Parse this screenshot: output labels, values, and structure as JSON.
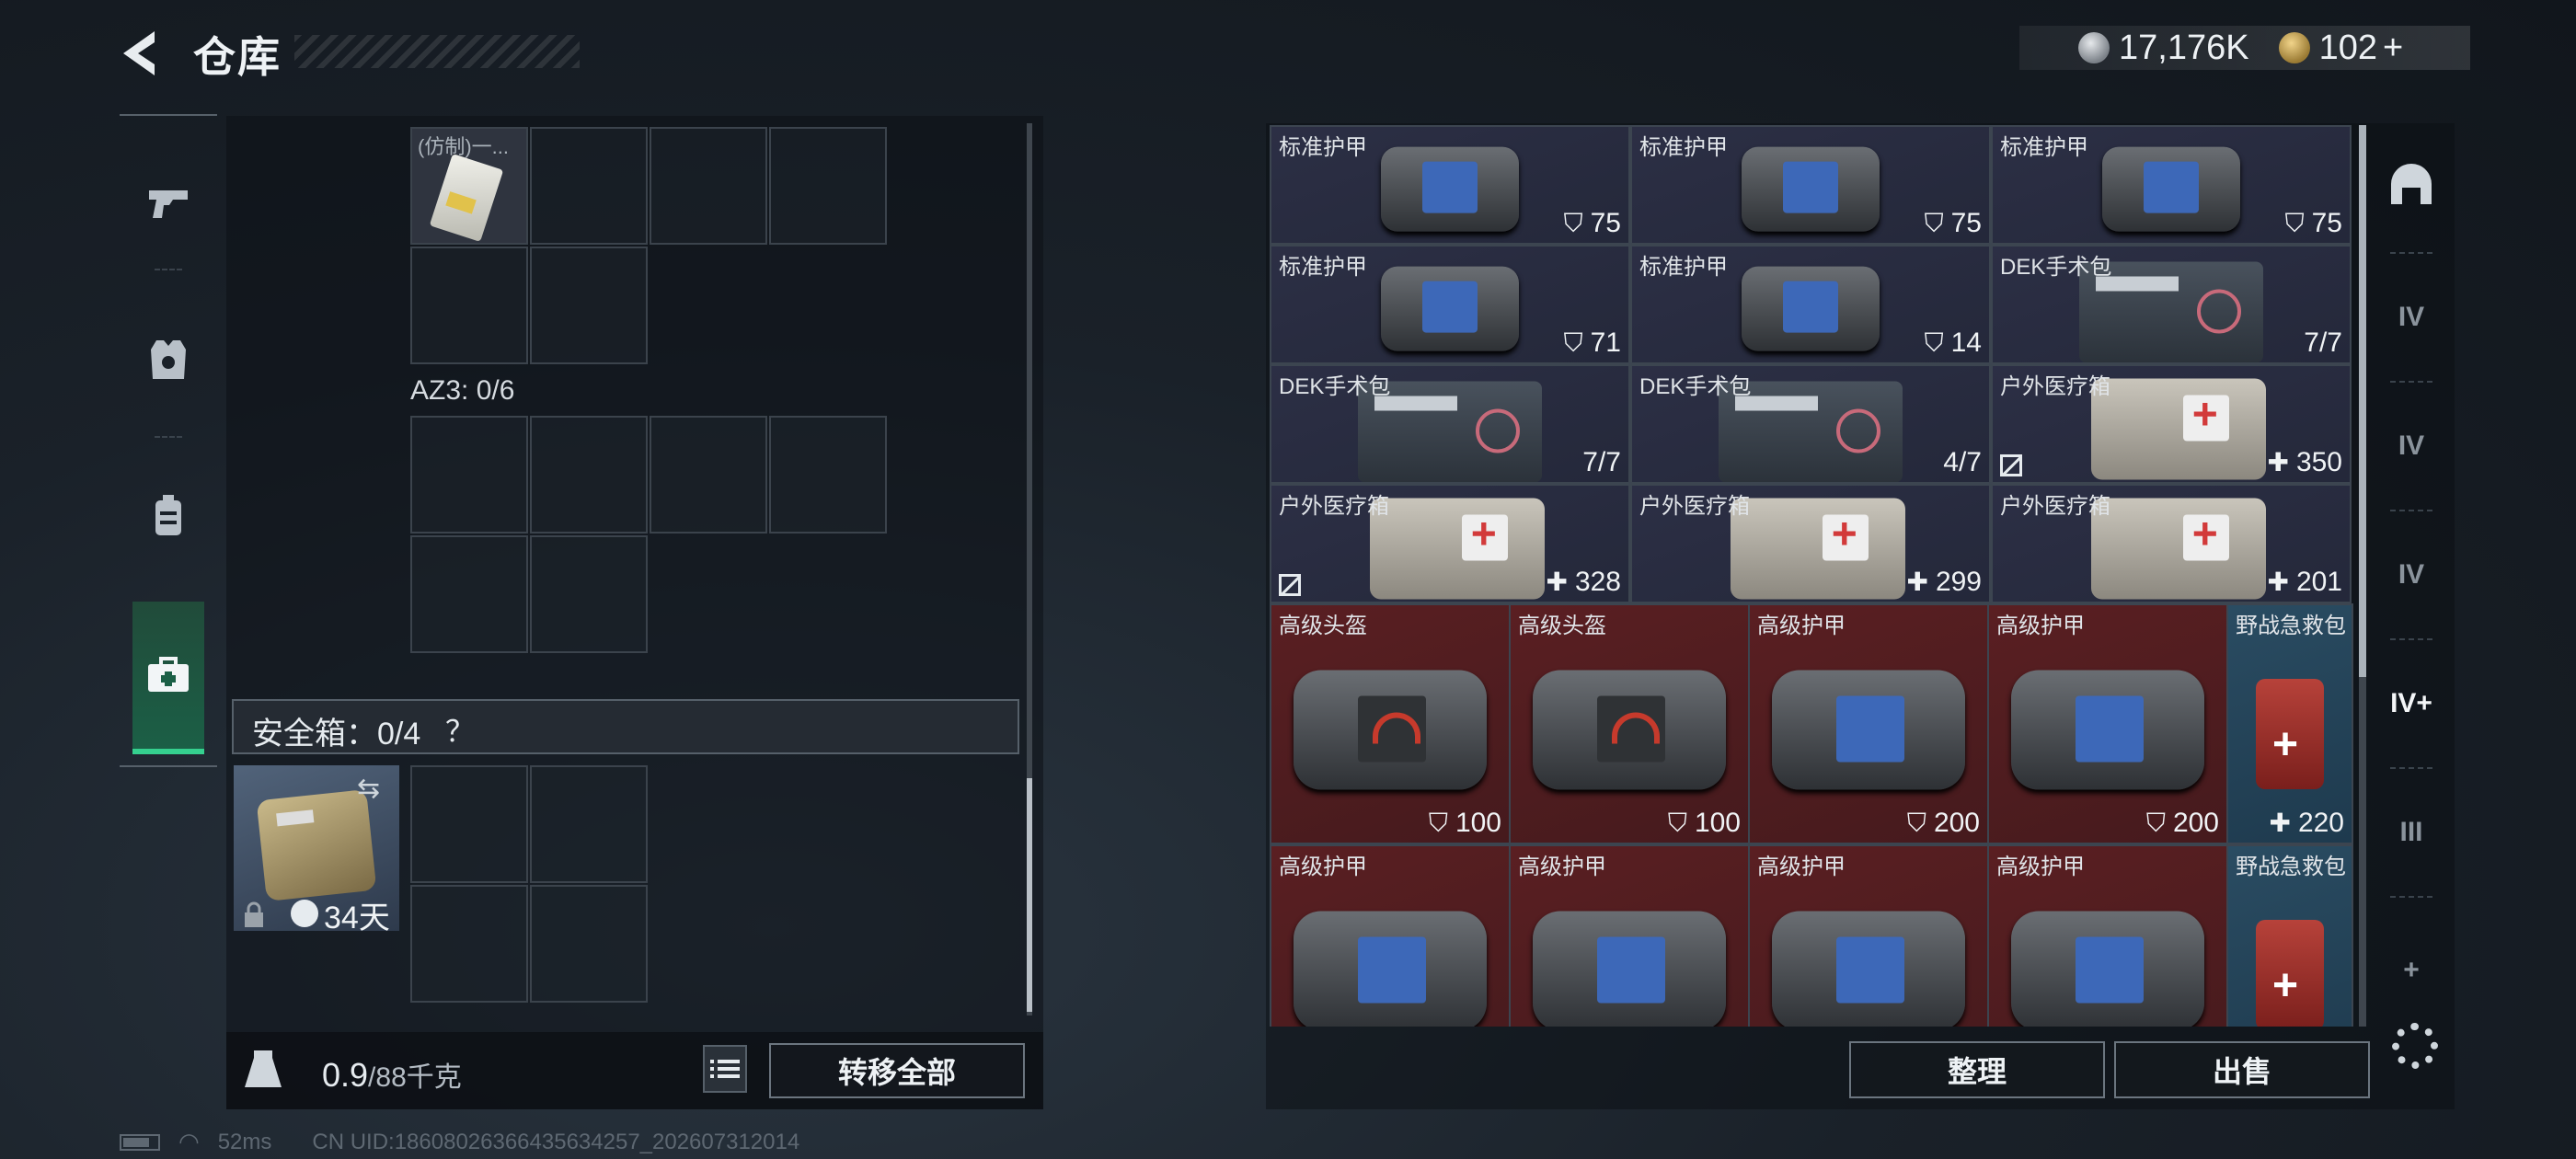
{
  "header": {
    "title": "仓库",
    "currency1": "17,176K",
    "currency2": "102"
  },
  "leftnav": {
    "items": [
      {
        "icon": "pistol-icon"
      },
      {
        "icon": "armor-vest-icon"
      },
      {
        "icon": "backpack-icon"
      },
      {
        "icon": "medkit-icon",
        "active": true
      }
    ]
  },
  "container": {
    "item1_label": "(仿制)一...",
    "az3_label": "AZ3: 0/6",
    "safe_label": "安全箱：0/4",
    "safe_help": "？",
    "safe_days": "34天",
    "weight_value": "0.9",
    "weight_max": "/88千克",
    "transfer_label": "转移全部"
  },
  "grid": {
    "items": [
      {
        "name": "标准护甲",
        "value": "75",
        "symbol": "shield",
        "kind": "vest",
        "bg": "std"
      },
      {
        "name": "标准护甲",
        "value": "75",
        "symbol": "shield",
        "kind": "vest",
        "bg": "std"
      },
      {
        "name": "标准护甲",
        "value": "75",
        "symbol": "shield",
        "kind": "vest",
        "bg": "std"
      },
      {
        "name": "标准护甲",
        "value": "71",
        "symbol": "shield",
        "kind": "vest",
        "bg": "std"
      },
      {
        "name": "标准护甲",
        "value": "14",
        "symbol": "shield",
        "kind": "vest",
        "bg": "std"
      },
      {
        "name": "DEK手术包",
        "value": "7/7",
        "symbol": "",
        "kind": "kit",
        "bg": "std"
      },
      {
        "name": "DEK手术包",
        "value": "7/7",
        "symbol": "",
        "kind": "kit",
        "bg": "std"
      },
      {
        "name": "DEK手术包",
        "value": "4/7",
        "symbol": "",
        "kind": "kit",
        "bg": "std"
      },
      {
        "name": "户外医疗箱",
        "value": "350",
        "symbol": "plus",
        "kind": "med",
        "bg": "std",
        "nodur": true
      },
      {
        "name": "户外医疗箱",
        "value": "328",
        "symbol": "plus",
        "kind": "med",
        "bg": "std",
        "nodur": true
      },
      {
        "name": "户外医疗箱",
        "value": "299",
        "symbol": "plus",
        "kind": "med",
        "bg": "std"
      },
      {
        "name": "户外医疗箱",
        "value": "201",
        "symbol": "plus",
        "kind": "med",
        "bg": "std"
      },
      {
        "name": "高级头盔",
        "value": "100",
        "symbol": "shield",
        "kind": "vest-red",
        "bg": "red"
      },
      {
        "name": "高级头盔",
        "value": "100",
        "symbol": "shield",
        "kind": "vest-red",
        "bg": "red"
      },
      {
        "name": "高级护甲",
        "value": "200",
        "symbol": "shield",
        "kind": "vest-big",
        "bg": "red"
      },
      {
        "name": "高级护甲",
        "value": "200",
        "symbol": "shield",
        "kind": "vest-big",
        "bg": "red"
      },
      {
        "name": "野战急救包",
        "value": "220",
        "symbol": "plus",
        "kind": "fak",
        "bg": "blue"
      },
      {
        "name": "高级护甲",
        "value": "",
        "symbol": "",
        "kind": "vest-big",
        "bg": "red"
      },
      {
        "name": "高级护甲",
        "value": "",
        "symbol": "",
        "kind": "vest-big",
        "bg": "red"
      },
      {
        "name": "高级护甲",
        "value": "",
        "symbol": "",
        "kind": "vest-big",
        "bg": "red"
      },
      {
        "name": "高级护甲",
        "value": "",
        "symbol": "",
        "kind": "vest-big",
        "bg": "red"
      },
      {
        "name": "野战急救包",
        "value": "",
        "symbol": "",
        "kind": "fak",
        "bg": "blue"
      }
    ]
  },
  "rightnav": {
    "items": [
      {
        "icon": "helmet-icon",
        "label": ""
      },
      {
        "icon": "tier4-folder-icon",
        "label": "IV"
      },
      {
        "icon": "tier4-weapon-icon",
        "label": "IV"
      },
      {
        "icon": "tier4-ammo-icon",
        "label": "IV"
      },
      {
        "icon": "tier4-medical-icon",
        "label": "IV+",
        "active": true
      },
      {
        "icon": "tier3-gear-icon",
        "label": "III"
      },
      {
        "icon": "add-icon",
        "label": "+"
      }
    ]
  },
  "actions": {
    "sort": "整理",
    "sell": "出售"
  },
  "status": {
    "ping": "52ms",
    "uid": "CN UID:18608026366435634257_202607312014"
  }
}
